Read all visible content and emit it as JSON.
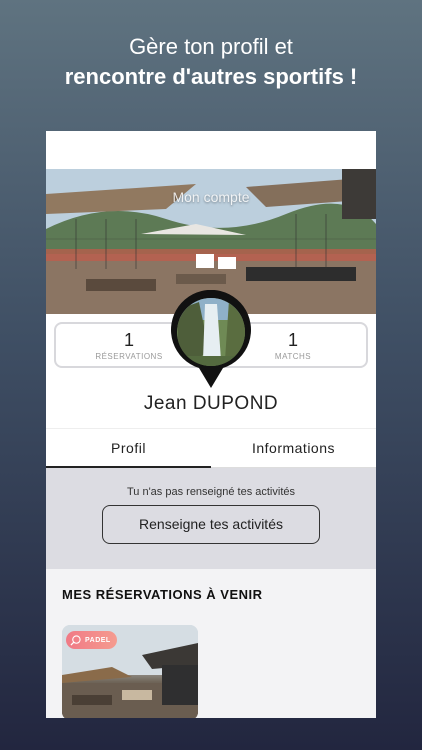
{
  "promo": {
    "line1": "Gère ton profil et",
    "line2": "rencontre d'autres sportifs !"
  },
  "header": {
    "title": "Mon compte"
  },
  "stats": {
    "reservations_count": "1",
    "reservations_label": "RÉSERVATIONS",
    "matchs_count": "1",
    "matchs_label": "MATCHS"
  },
  "profile": {
    "first_name": "Jean",
    "last_name": "DUPOND"
  },
  "tabs": [
    {
      "label": "Profil"
    },
    {
      "label": "Informations"
    }
  ],
  "activities": {
    "message": "Tu n'as pas renseigné tes activités",
    "button_label": "Renseigne tes activités"
  },
  "reservations": {
    "section_title": "MES RÉSERVATIONS À VENIR",
    "cards": [
      {
        "badge": "PADEL",
        "badge_icon": "racket-icon"
      }
    ]
  },
  "colors": {
    "badge_start": "#f07a86",
    "badge_end": "#f59b8f",
    "activities_bg": "#dcdce2"
  }
}
